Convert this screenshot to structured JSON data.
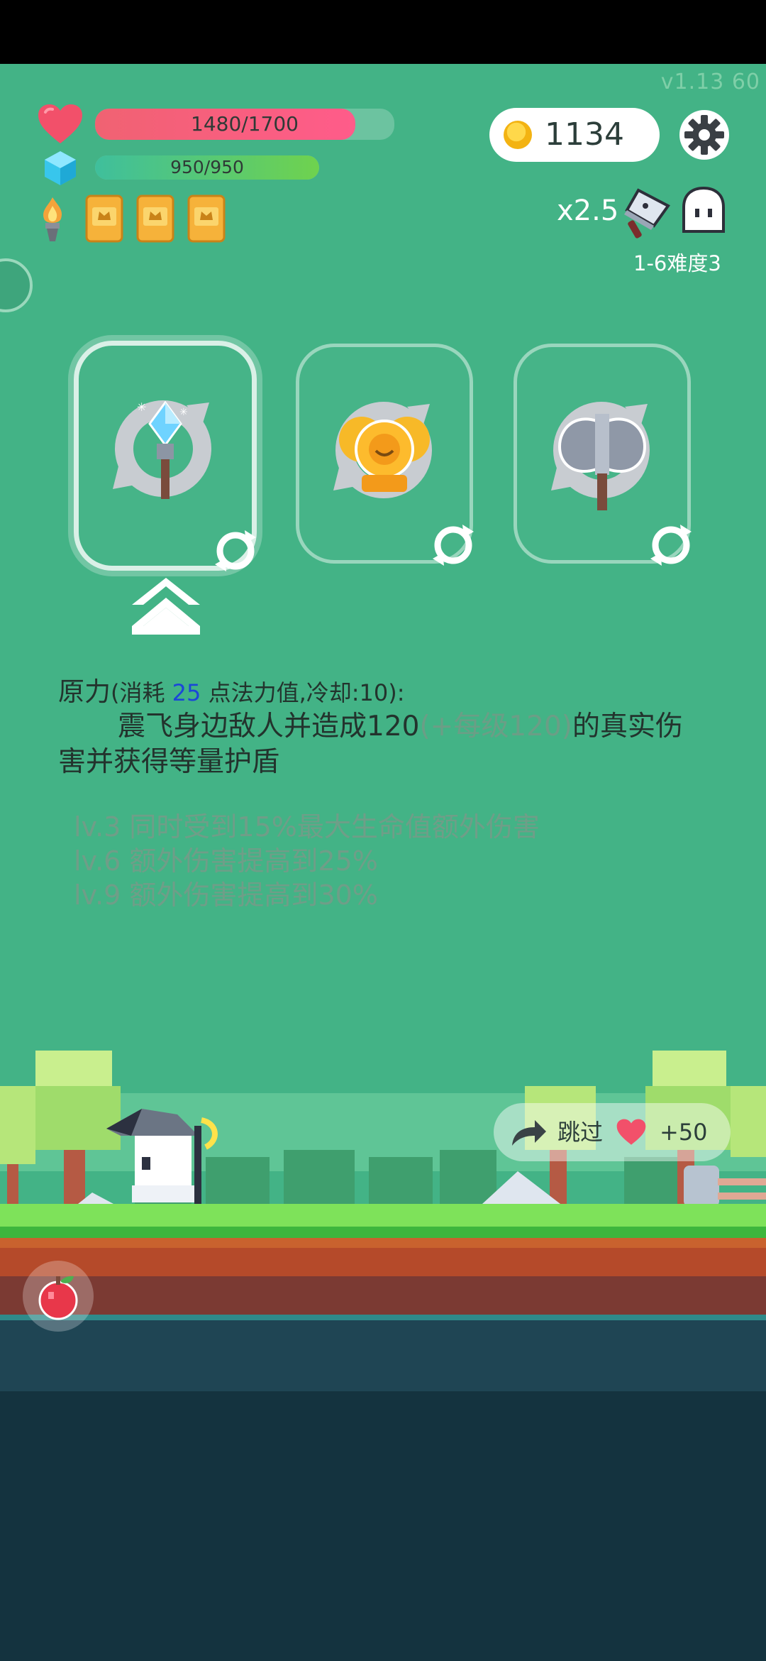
{
  "status_bar": {},
  "hud": {
    "version": "v1.13 60",
    "hp": {
      "text": "1480/1700",
      "current": 1480,
      "max": 1700
    },
    "mp": {
      "text": "950/950",
      "current": 950,
      "max": 950
    },
    "coins": "1134",
    "multiplier": "x2.5",
    "stage": "1-6难度3",
    "inventory_icons": [
      "flame-torch-icon",
      "spell-book-icon",
      "spell-book-icon",
      "spell-book-icon"
    ]
  },
  "cards": [
    {
      "name": "ice-wand",
      "icon": "crystal-wand-icon",
      "selected": true
    },
    {
      "name": "golden-bells",
      "icon": "golden-bells-icon",
      "selected": false
    },
    {
      "name": "battle-axe",
      "icon": "battle-axe-icon",
      "selected": false
    }
  ],
  "description": {
    "title": "原力",
    "cost_prefix": "(消耗 ",
    "cost_value": "25",
    "cost_suffix": " 点法力值,冷却:10):",
    "body_main": "震飞身边敌人并造成120",
    "body_bonus": "(+每级120)",
    "body_end": "的真实伤",
    "body_line2": "害并获得等量护盾",
    "levels": [
      "lv.3 同时受到15%最大生命值额外伤害",
      "lv.6 额外伤害提高到25%",
      "lv.9 额外伤害提高到30%"
    ]
  },
  "skip": {
    "label": "跳过",
    "reward": "+50"
  },
  "colors": {
    "background": "#43b386",
    "hp_fill": "#ff5c8a",
    "mp_fill": "#6fd24e",
    "accent_blue": "#1b47d8"
  }
}
